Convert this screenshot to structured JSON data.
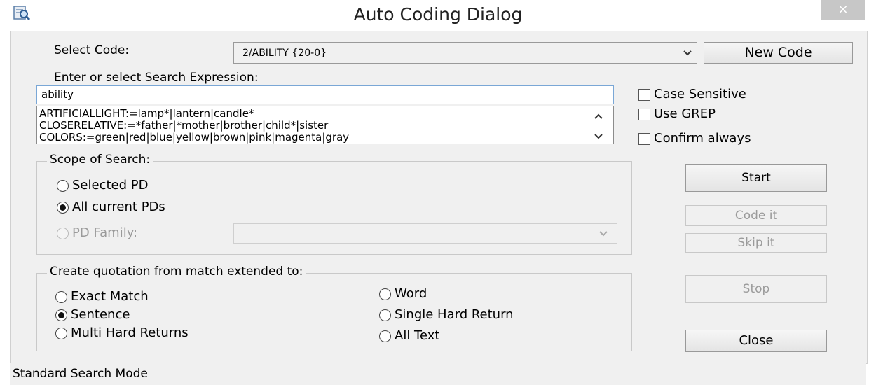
{
  "window": {
    "title": "Auto Coding Dialog",
    "close_glyph": "×",
    "icon": "app-search-icon"
  },
  "select_code": {
    "label": "Select Code:",
    "value": "2/ABILITY {20-0}",
    "new_code_label": "New Code"
  },
  "search": {
    "label": "Enter or select Search Expression:",
    "value": "ability",
    "items": [
      "ARTIFICIALLIGHT:=lamp*|lantern|candle*",
      "CLOSERELATIVE:=*father|*mother|brother|child*|sister",
      "COLORS:=green|red|blue|yellow|brown|pink|magenta|gray"
    ]
  },
  "options": {
    "case_sensitive": {
      "label": "Case Sensitive",
      "checked": false
    },
    "use_grep": {
      "label": "Use GREP",
      "checked": false
    },
    "confirm_always": {
      "label": "Confirm always",
      "checked": false
    }
  },
  "scope": {
    "title": "Scope of Search:",
    "selected_pd": "Selected PD",
    "all_current_pds": "All current PDs",
    "pd_family": "PD Family:",
    "selected": "All current PDs"
  },
  "quotation": {
    "title": "Create quotation from match extended to:",
    "exact_match": "Exact Match",
    "sentence": "Sentence",
    "multi_hard_returns": "Multi Hard Returns",
    "word": "Word",
    "single_hard_return": "Single Hard Return",
    "all_text": "All Text",
    "selected": "Sentence"
  },
  "buttons": {
    "start": "Start",
    "code_it": "Code it",
    "skip_it": "Skip it",
    "stop": "Stop",
    "close": "Close"
  },
  "status": {
    "text": "Standard Search Mode"
  }
}
